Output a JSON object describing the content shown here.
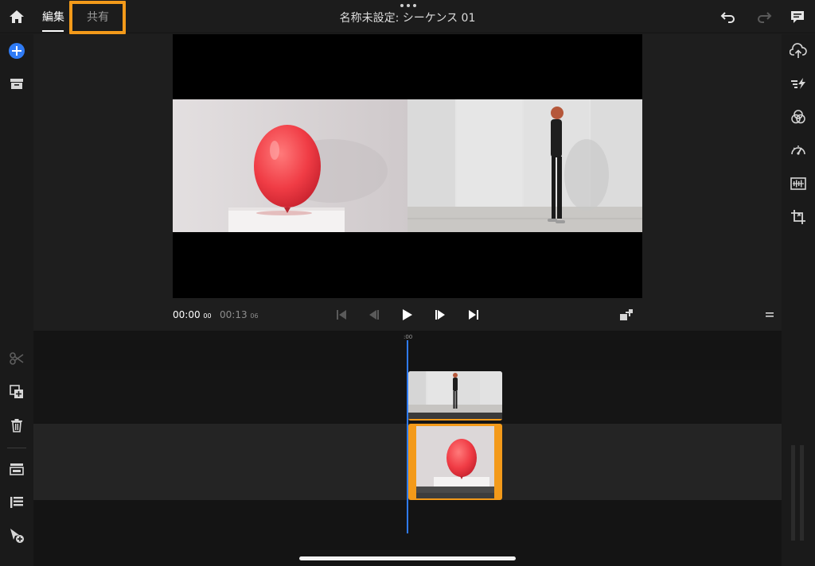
{
  "topbar": {
    "tab_edit": "編集",
    "tab_share": "共有",
    "title": "名称未設定: シーケンス 01",
    "highlight_color": "#f39a1a"
  },
  "icons": {
    "home": "home-icon",
    "undo": "undo-icon",
    "redo": "redo-icon",
    "comment": "comment-icon",
    "add_media": "add-media-icon",
    "project": "project-archive-icon",
    "split": "scissors-icon",
    "duplicate": "duplicate-icon",
    "delete": "trash-icon",
    "track_overlay": "track-overlay-icon",
    "arrange": "arrange-list-icon",
    "add_to_timeline": "cursor-add-icon",
    "upload": "cloud-upload-icon",
    "auto_reframe": "auto-reframe-icon",
    "color": "color-circles-icon",
    "speed": "speedometer-icon",
    "audio": "audio-waveform-icon",
    "crop": "crop-icon",
    "fullscreen": "fullscreen-icon",
    "options": "menu-lines-icon"
  },
  "transport": {
    "current_time": "00:00",
    "current_frames": "00",
    "duration_time": "00:13",
    "duration_frames": "06"
  },
  "timeline": {
    "ruler_label": ":00",
    "playhead_color": "#2f7bf5"
  }
}
